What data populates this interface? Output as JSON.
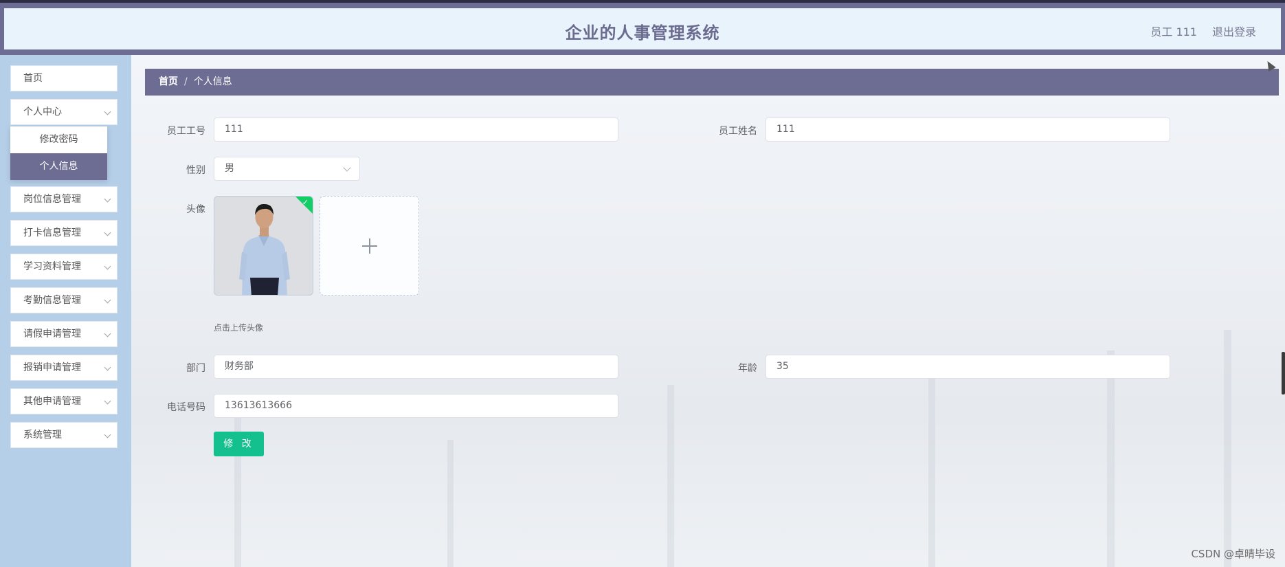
{
  "header": {
    "title": "企业的人事管理系统",
    "user": "员工 111",
    "logout": "退出登录"
  },
  "sidebar": {
    "items": [
      {
        "label": "首页"
      },
      {
        "label": "个人中心"
      },
      {
        "label": "岗位信息管理"
      },
      {
        "label": "打卡信息管理"
      },
      {
        "label": "学习资料管理"
      },
      {
        "label": "考勤信息管理"
      },
      {
        "label": "请假申请管理"
      },
      {
        "label": "报销申请管理"
      },
      {
        "label": "其他申请管理"
      },
      {
        "label": "系统管理"
      }
    ],
    "submenu": [
      {
        "label": "修改密码"
      },
      {
        "label": "个人信息"
      }
    ]
  },
  "breadcrumb": {
    "home": "首页",
    "separator": "/",
    "current": "个人信息"
  },
  "form": {
    "employee_id": {
      "label": "员工工号",
      "value": "111"
    },
    "employee_name": {
      "label": "员工姓名",
      "value": "111"
    },
    "gender": {
      "label": "性别",
      "value": "男"
    },
    "avatar": {
      "label": "头像",
      "tip": "点击上传头像"
    },
    "department": {
      "label": "部门",
      "value": "财务部"
    },
    "age": {
      "label": "年龄",
      "value": "35"
    },
    "phone": {
      "label": "电话号码",
      "value": "13613613666"
    },
    "submit_label": "修 改"
  },
  "watermark": "CSDN @卓晴毕设",
  "colors": {
    "primary": "#6d6d93",
    "sidebar_bg": "#b5cfe9",
    "header_bg": "#e8f3fc",
    "button": "#13c08e",
    "upload_success": "#13ce66"
  }
}
